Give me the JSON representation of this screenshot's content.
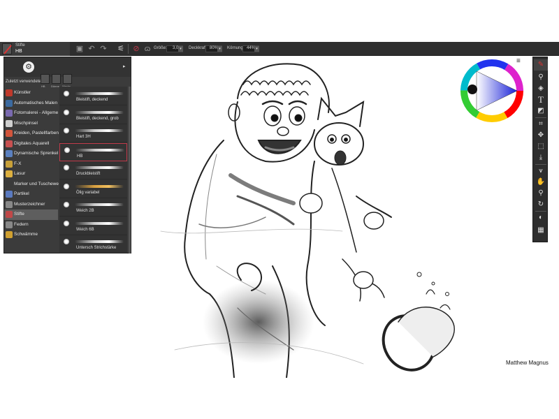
{
  "brush": {
    "category": "Stifte",
    "variant": "HB"
  },
  "props": {
    "size_label": "Größe:",
    "size_value": "3,0",
    "opacity_label": "Deckkraft:",
    "opacity_value": "80%",
    "grain_label": "Körnung:",
    "grain_value": "44%"
  },
  "panel": {
    "recent_label": "Zuletzt verwendete...",
    "recent_items": [
      "HB",
      "Dünne...",
      "Wachs..."
    ],
    "categories": [
      {
        "label": "Künstler",
        "icon": "artist-icon",
        "color": "#c0392b"
      },
      {
        "label": "Automatisches Malen",
        "icon": "auto-paint-icon",
        "color": "#3b6aa0"
      },
      {
        "label": "Fotomalerei - Allgeme",
        "icon": "photo-paint-icon",
        "color": "#7a6ab0"
      },
      {
        "label": "Mischpinsel",
        "icon": "blender-icon",
        "color": "#cfcfcf"
      },
      {
        "label": "Kreiden, Pastellfarben",
        "icon": "chalk-icon",
        "color": "#d2553c"
      },
      {
        "label": "Digitales Aquarell",
        "icon": "watercolor-icon",
        "color": "#c85050"
      },
      {
        "label": "Dynamische Sprenkel",
        "icon": "speckle-icon",
        "color": "#5a80c0"
      },
      {
        "label": "F-X",
        "icon": "fx-icon",
        "color": "#c8a038"
      },
      {
        "label": "Lasur",
        "icon": "glaze-icon",
        "color": "#ddb040"
      },
      {
        "label": "Marker und Tuschewe",
        "icon": "marker-icon",
        "color": "#3a3a3a"
      },
      {
        "label": "Partikel",
        "icon": "particle-icon",
        "color": "#5a7ac0"
      },
      {
        "label": "Musterzeichner",
        "icon": "pattern-icon",
        "color": "#888888"
      },
      {
        "label": "Stifte",
        "icon": "pencil-icon",
        "color": "#c04848"
      },
      {
        "label": "Federn",
        "icon": "pen-icon",
        "color": "#888888"
      },
      {
        "label": "Schwämme",
        "icon": "sponge-icon",
        "color": "#d0a030"
      }
    ],
    "variants": [
      {
        "label": "Bleistift, deckend"
      },
      {
        "label": "Bleistift, deckend, grob"
      },
      {
        "label": "Hart 3H"
      },
      {
        "label": "HB"
      },
      {
        "label": "Druckbleistift"
      },
      {
        "label": "Ölig variabel"
      },
      {
        "label": "Weich 2B"
      },
      {
        "label": "Weich 6B"
      },
      {
        "label": "Untersch Strichstärke"
      }
    ],
    "selected_variant": "HB",
    "selected_category": "Stifte"
  },
  "tools": [
    "brush-tool-icon",
    "eyedropper-icon",
    "paint-bucket-icon",
    "text-icon",
    "eraser-icon",
    "crop-icon",
    "transform-icon",
    "rect-select-icon",
    "layer-adjust-icon",
    "mirror-icon",
    "grabber-icon",
    "magnifier-icon",
    "rotate-icon",
    "color-swatch-icon",
    "pattern-icon"
  ],
  "accent_color": "#c0394a",
  "signature": "Matthew Magnus"
}
